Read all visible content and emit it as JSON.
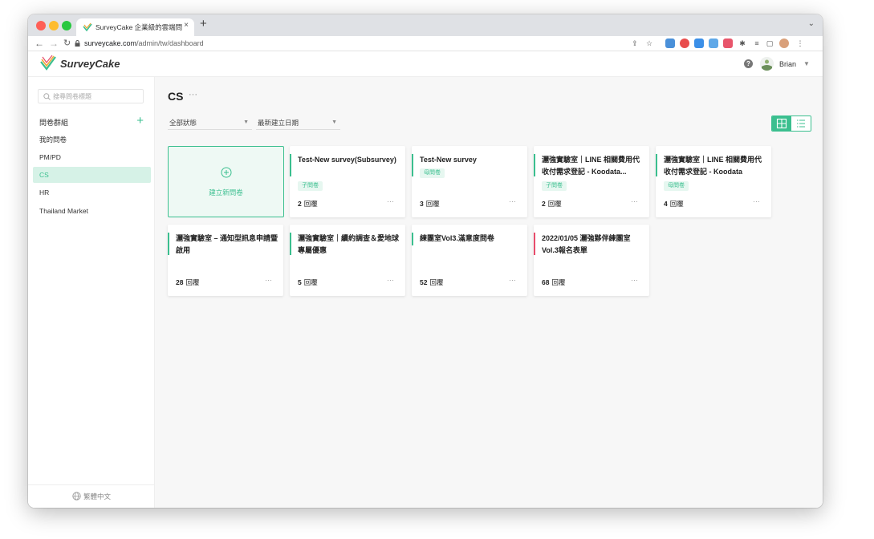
{
  "browser": {
    "tab_title": "SurveyCake 企業級的雲端問卷系統",
    "url_domain": "surveycake.com",
    "url_path": "/admin/tw/dashboard"
  },
  "header": {
    "logo_text": "SurveyCake",
    "user_name": "Brian"
  },
  "sidebar": {
    "search_placeholder": "搜尋問卷標題",
    "group_header": "問卷群組",
    "items": [
      {
        "label": "我的問卷",
        "active": false
      },
      {
        "label": "PM/PD",
        "active": false
      },
      {
        "label": "CS",
        "active": true
      },
      {
        "label": "HR",
        "active": false
      },
      {
        "label": "Thailand Market",
        "active": false
      }
    ],
    "language": "繁體中文"
  },
  "main": {
    "title": "CS",
    "filters": [
      "全部狀態",
      "最新建立日期"
    ],
    "new_survey_label": "建立新問卷",
    "cards": [
      {
        "title": "Test-New survey(Subsurvey)",
        "badge": "子問卷",
        "count": "2",
        "unit": "回覆",
        "bar_color": "#3bbf8f"
      },
      {
        "title": "Test-New survey",
        "badge": "母問卷",
        "count": "3",
        "unit": "回覆",
        "bar_color": "#3bbf8f"
      },
      {
        "title": "灑強實驗室｜LINE 相關費用代收付需求登記 - Koodata...",
        "badge": "子問卷",
        "count": "2",
        "unit": "回覆",
        "bar_color": "#3bbf8f"
      },
      {
        "title": "灑強實驗室｜LINE 相關費用代收付需求登記 - Koodata",
        "badge": "母問卷",
        "count": "4",
        "unit": "回覆",
        "bar_color": "#3bbf8f"
      },
      {
        "title": "灑強實驗室 – 通知型訊息申請暨啟用",
        "badge": "",
        "count": "28",
        "unit": "回覆",
        "bar_color": "#3bbf8f"
      },
      {
        "title": "灑強實驗室｜續約調查＆愛地球專屬優惠",
        "badge": "",
        "count": "5",
        "unit": "回覆",
        "bar_color": "#3bbf8f"
      },
      {
        "title": "練團室Vol3.滿意度問卷",
        "badge": "",
        "count": "52",
        "unit": "回覆",
        "bar_color": "#3bbf8f"
      },
      {
        "title": "2022/01/05 灑強夥伴練團室 Vol.3報名表單",
        "badge": "",
        "count": "68",
        "unit": "回覆",
        "bar_color": "#e84c6b"
      }
    ]
  }
}
